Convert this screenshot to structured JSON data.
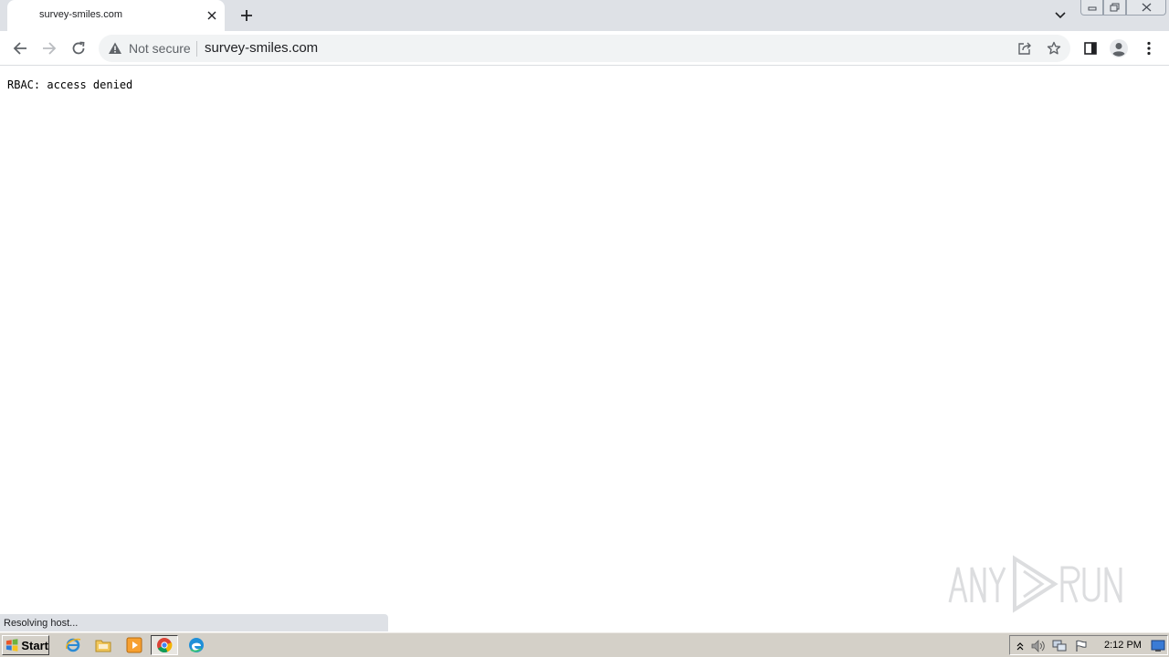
{
  "tab": {
    "title": "survey-smiles.com"
  },
  "omnibox": {
    "security_label": "Not secure",
    "url": "survey-smiles.com"
  },
  "page": {
    "message": "RBAC: access denied"
  },
  "status_bar": {
    "text": "Resolving host..."
  },
  "taskbar": {
    "start_label": "Start",
    "clock": "2:12 PM"
  },
  "colors": {
    "tabstrip": "#dee1e6",
    "toolbar_icon": "#5f6368",
    "omnibox_bg": "#f1f3f4",
    "taskbar": "#d4d0c8"
  },
  "icons": [
    "close-icon",
    "plus-icon",
    "chevron-down-icon",
    "back-arrow-icon",
    "forward-arrow-icon",
    "reload-icon",
    "warning-icon",
    "share-icon",
    "star-icon",
    "side-panel-icon",
    "profile-icon",
    "more-vert-icon"
  ]
}
